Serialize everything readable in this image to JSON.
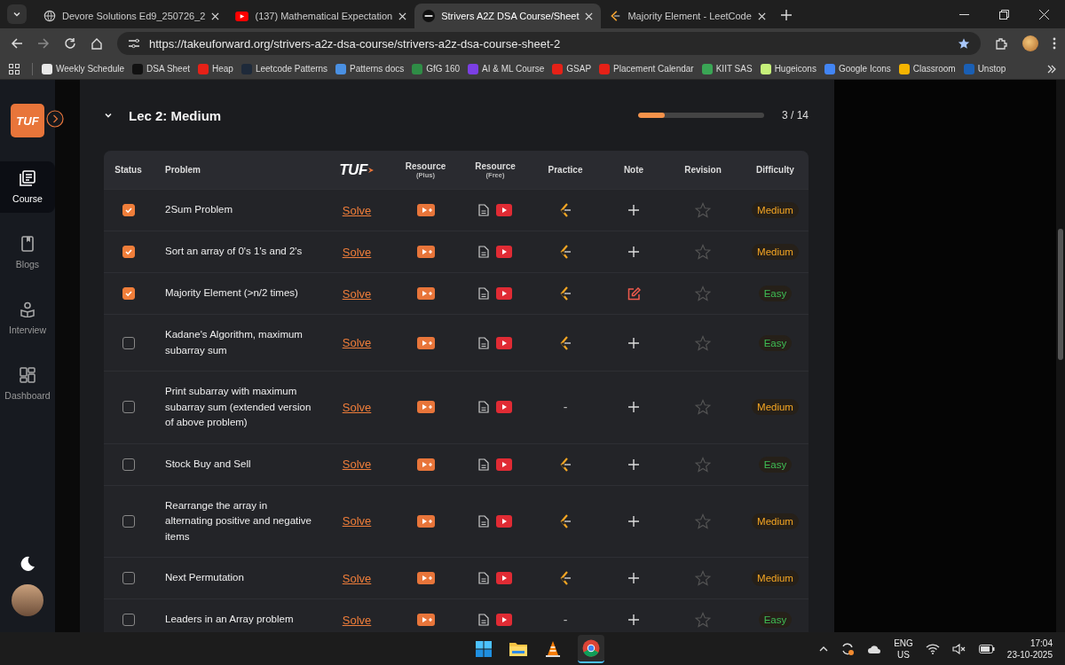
{
  "browser": {
    "tabs": [
      {
        "title": "Devore Solutions Ed9_250726_2",
        "kind": "globe",
        "selected": false
      },
      {
        "title": "(137) Mathematical Expectation",
        "kind": "youtube",
        "selected": false
      },
      {
        "title": "Strivers A2Z DSA Course/Sheet",
        "kind": "tuf",
        "selected": true
      },
      {
        "title": "Majority Element - LeetCode",
        "kind": "leetcode",
        "selected": false
      }
    ],
    "url": "https://takeuforward.org/strivers-a2z-dsa-course/strivers-a2z-dsa-course-sheet-2",
    "bookmarks": [
      {
        "label": "Weekly Schedule",
        "color": "#e8e8e8"
      },
      {
        "label": "DSA Sheet",
        "color": "#111111"
      },
      {
        "label": "Heap",
        "color": "#e62117"
      },
      {
        "label": "Leetcode Patterns",
        "color": "#1e2a3a"
      },
      {
        "label": "Patterns docs",
        "color": "#4a90e2"
      },
      {
        "label": "GfG 160",
        "color": "#2f8d46"
      },
      {
        "label": "AI & ML Course",
        "color": "#7b3fe4"
      },
      {
        "label": "GSAP",
        "color": "#e62117"
      },
      {
        "label": "Placement Calendar",
        "color": "#e62117"
      },
      {
        "label": "KIIT SAS",
        "color": "#3aa655"
      },
      {
        "label": "Hugeicons",
        "color": "#c6f07a"
      },
      {
        "label": "Google Icons",
        "color": "#4285f4"
      },
      {
        "label": "Classroom",
        "color": "#f4b400"
      },
      {
        "label": "Unstop",
        "color": "#1a5fb4"
      }
    ]
  },
  "sidebar": {
    "logo": "TUF",
    "items": [
      {
        "label": "Course",
        "kind": "course",
        "selected": true
      },
      {
        "label": "Blogs",
        "kind": "blogs",
        "selected": false
      },
      {
        "label": "Interview",
        "kind": "interview",
        "selected": false
      },
      {
        "label": "Dashboard",
        "kind": "dashboard",
        "selected": false
      }
    ]
  },
  "section": {
    "title": "Lec 2: Medium",
    "expanded": true,
    "progress": {
      "level": 0.21,
      "reading": "3 / 14"
    }
  },
  "table": {
    "columns": [
      {
        "label": "Status",
        "kind": "text"
      },
      {
        "label": "Problem",
        "kind": "text"
      },
      {
        "label": "TUF",
        "kind": "logo"
      },
      {
        "label": "Resource",
        "sub": "(Plus)",
        "kind": "text"
      },
      {
        "label": "Resource",
        "sub": "(Free)",
        "kind": "text"
      },
      {
        "label": "Practice",
        "kind": "text"
      },
      {
        "label": "Note",
        "kind": "text"
      },
      {
        "label": "Revision",
        "kind": "text"
      },
      {
        "label": "Difficulty",
        "kind": "text"
      }
    ],
    "rows": [
      {
        "checked": true,
        "problem": "2Sum Problem",
        "solve": "Solve",
        "practice": {
          "kind": "link"
        },
        "has_note": false,
        "starred": false,
        "difficulty": "Medium",
        "color": "#f5a623"
      },
      {
        "checked": true,
        "problem": "Sort an array of 0's 1's and 2's",
        "solve": "Solve",
        "practice": {
          "kind": "link"
        },
        "has_note": false,
        "starred": false,
        "difficulty": "Medium",
        "color": "#f5a623"
      },
      {
        "checked": true,
        "problem": "Majority Element (>n/2 times)",
        "solve": "Solve",
        "practice": {
          "kind": "link"
        },
        "has_note": true,
        "starred": false,
        "difficulty": "Easy",
        "color": "#3fbf55"
      },
      {
        "checked": false,
        "problem": "Kadane's Algorithm, maximum subarray sum",
        "solve": "Solve",
        "practice": {
          "kind": "link"
        },
        "has_note": false,
        "starred": false,
        "difficulty": "Easy",
        "color": "#3fbf55"
      },
      {
        "checked": false,
        "problem": "Print subarray with maximum subarray sum (extended version of above problem)",
        "solve": "Solve",
        "practice": {
          "kind": "none",
          "text": "-"
        },
        "has_note": false,
        "starred": false,
        "difficulty": "Medium",
        "color": "#f5a623"
      },
      {
        "checked": false,
        "problem": "Stock Buy and Sell",
        "solve": "Solve",
        "practice": {
          "kind": "link"
        },
        "has_note": false,
        "starred": false,
        "difficulty": "Easy",
        "color": "#3fbf55"
      },
      {
        "checked": false,
        "problem": "Rearrange the array in alternating positive and negative items",
        "solve": "Solve",
        "practice": {
          "kind": "link"
        },
        "has_note": false,
        "starred": false,
        "difficulty": "Medium",
        "color": "#f5a623"
      },
      {
        "checked": false,
        "problem": "Next Permutation",
        "solve": "Solve",
        "practice": {
          "kind": "link"
        },
        "has_note": false,
        "starred": false,
        "difficulty": "Medium",
        "color": "#f5a623"
      },
      {
        "checked": false,
        "problem": "Leaders in an Array problem",
        "solve": "Solve",
        "practice": {
          "kind": "none",
          "text": "-"
        },
        "has_note": false,
        "starred": false,
        "difficulty": "Easy",
        "color": "#3fbf55"
      }
    ]
  },
  "taskbar": {
    "language": "ENG",
    "region": "US",
    "time": "17:04",
    "date": "23-10-2025"
  }
}
